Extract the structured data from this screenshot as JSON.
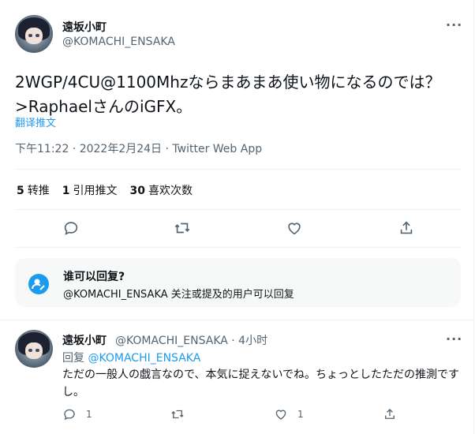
{
  "tweet": {
    "author_name": "遠坂小町",
    "author_handle": "@KOMACHI_ENSAKA",
    "more_label": "···",
    "text": "2WGP/4CU@1100Mhzならまあまあ使い物になるのでは？ >RaphaelさんのiGFX。",
    "translate_label": "翻译推文",
    "meta": "下午11:22 · 2022年2月24日 · Twitter Web App"
  },
  "stats": {
    "retweets_count": "5",
    "retweets_label": "转推",
    "quotes_count": "1",
    "quotes_label": "引用推文",
    "likes_count": "30",
    "likes_label": "喜欢次数"
  },
  "actions": {
    "icons": [
      "reply-icon",
      "retweet-icon",
      "like-icon",
      "share-icon"
    ]
  },
  "reply_restriction": {
    "title": "谁可以回复?",
    "description": "@KOMACHI_ENSAKA 关注或提及的用户可以回复"
  },
  "reply": {
    "author_name": "遠坂小町",
    "handle_time": "@KOMACHI_ENSAKA · 4小时",
    "more_label": "···",
    "replying_prefix": "回复",
    "replying_handle": "@KOMACHI_ENSAKA",
    "text": "ただの一般人の戯言なので、本気に捉えないでね。ちょっとしたただの推測ですし。",
    "reply_count": "1",
    "like_count": "1"
  },
  "colors": {
    "accent": "#1d9bf0",
    "secondary_text": "#536471",
    "divider": "#eff3f4"
  }
}
